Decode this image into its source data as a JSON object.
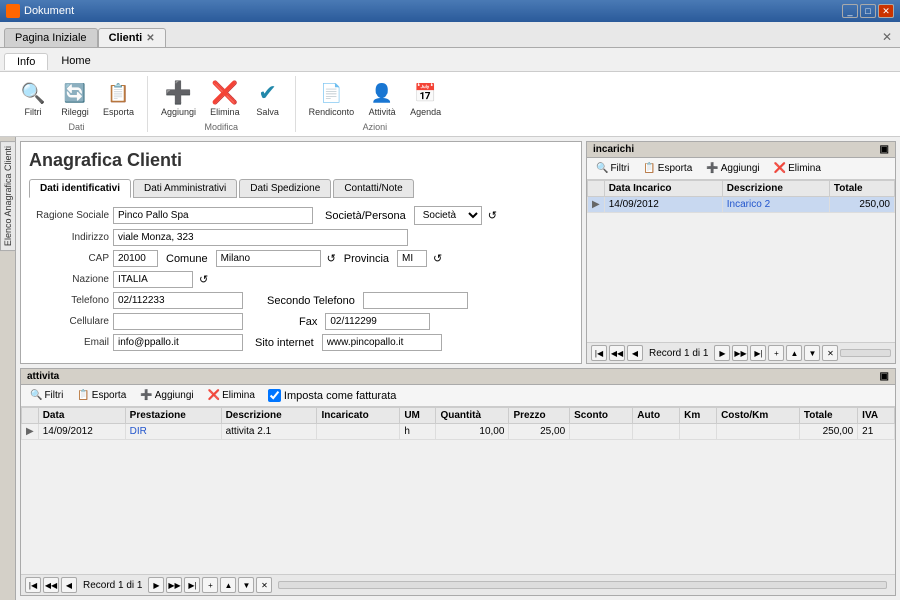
{
  "titlebar": {
    "title": "Dokument",
    "controls": [
      "_",
      "□",
      "✕"
    ]
  },
  "tabs": [
    {
      "id": "pagina-iniziale",
      "label": "Pagina Iniziale",
      "closable": false,
      "active": false
    },
    {
      "id": "clienti",
      "label": "Clienti",
      "closable": true,
      "active": true
    }
  ],
  "ribbon": {
    "tabs": [
      "Info",
      "Home"
    ],
    "active_tab": "Info",
    "groups": [
      {
        "label": "Dati",
        "buttons": [
          {
            "id": "filtri",
            "label": "Filtri",
            "icon": "🔍"
          },
          {
            "id": "rileggi",
            "label": "Rileggi",
            "icon": "🔄"
          },
          {
            "id": "esporta",
            "label": "Esporta",
            "icon": "📋"
          }
        ]
      },
      {
        "label": "Modifica",
        "buttons": [
          {
            "id": "aggiungi",
            "label": "Aggiungi",
            "icon": "➕"
          },
          {
            "id": "elimina",
            "label": "Elimina",
            "icon": "❌"
          },
          {
            "id": "salva",
            "label": "Salva",
            "icon": "✔"
          }
        ]
      },
      {
        "label": "Azioni",
        "buttons": [
          {
            "id": "rendiconto",
            "label": "Rendiconto",
            "icon": "📄"
          },
          {
            "id": "attivita",
            "label": "Attività",
            "icon": "👤"
          },
          {
            "id": "agenda",
            "label": "Agenda",
            "icon": "📅"
          }
        ]
      }
    ]
  },
  "form": {
    "title": "Anagrafica Clienti",
    "tabs": [
      "Dati identificativi",
      "Dati Amministrativi",
      "Dati Spedizione",
      "Contatti/Note"
    ],
    "active_tab": "Dati identificativi",
    "fields": {
      "ragione_sociale_label": "Ragione Sociale",
      "ragione_sociale_value": "Pinco Pallo Spa",
      "societa_persona_label": "Società/Persona",
      "societa_persona_value": "Società",
      "indirizzo_label": "Indirizzo",
      "indirizzo_value": "viale Monza, 323",
      "cap_label": "CAP",
      "cap_value": "20100",
      "comune_label": "Comune",
      "comune_value": "Milano",
      "provincia_label": "Provincia",
      "provincia_value": "MI",
      "nazione_label": "Nazione",
      "nazione_value": "ITALIA",
      "telefono_label": "Telefono",
      "telefono_value": "02/112233",
      "secondo_telefono_label": "Secondo Telefono",
      "secondo_telefono_value": "",
      "cellulare_label": "Cellulare",
      "cellulare_value": "",
      "fax_label": "Fax",
      "fax_value": "02/112299",
      "email_label": "Email",
      "email_value": "info@ppallo.it",
      "sito_internet_label": "Sito internet",
      "sito_internet_value": "www.pincopallo.it"
    }
  },
  "incarichi": {
    "title": "incarichi",
    "toolbar": {
      "filtri": "Filtri",
      "esporta": "Esporta",
      "aggiungi": "Aggiungi",
      "elimina": "Elimina"
    },
    "columns": [
      "Data Incarico",
      "Descrizione",
      "Totale"
    ],
    "rows": [
      {
        "data_incarico": "14/09/2012",
        "descrizione": "Incarico 2",
        "totale": "250,00",
        "selected": true
      }
    ],
    "nav_text": "Record 1 di 1"
  },
  "attivita": {
    "title": "attivita",
    "toolbar": {
      "filtri": "Filtri",
      "esporta": "Esporta",
      "aggiungi": "Aggiungi",
      "elimina": "Elimina",
      "imposta": "Imposta come fatturata"
    },
    "columns": [
      "Data",
      "Prestazione",
      "Descrizione",
      "Incaricato",
      "UM",
      "Quantità",
      "Prezzo",
      "Sconto",
      "Auto",
      "Km",
      "Costo/Km",
      "Totale",
      "IVA"
    ],
    "rows": [
      {
        "data": "14/09/2012",
        "prestazione": "DIR",
        "descrizione": "attivita 2.1",
        "incaricato": "",
        "um": "h",
        "quantita": "10,00",
        "prezzo": "25,00",
        "sconto": "",
        "auto": "",
        "km": "",
        "costo_km": "",
        "totale": "250,00",
        "iva": "21"
      }
    ],
    "nav_text": "Record 1 di 1"
  },
  "sidebar": {
    "label": "Elenco Anagrafica Clienti"
  }
}
